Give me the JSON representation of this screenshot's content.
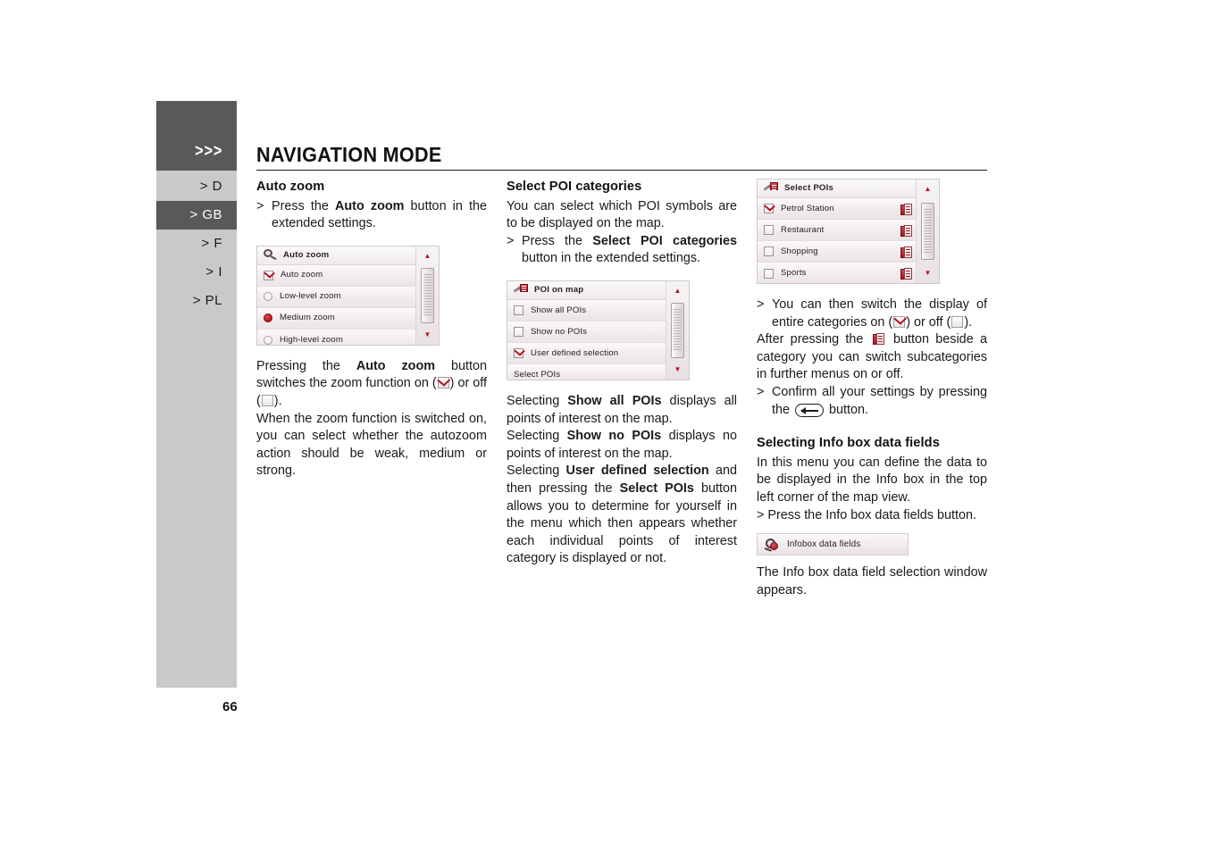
{
  "sidebar": {
    "chevrons": ">>>",
    "languages": [
      {
        "label": "> D",
        "active": false
      },
      {
        "label": "> GB",
        "active": true
      },
      {
        "label": "> F",
        "active": false
      },
      {
        "label": "> I",
        "active": false
      },
      {
        "label": "> PL",
        "active": false
      }
    ]
  },
  "header": {
    "title": "NAVIGATION MODE"
  },
  "page_number": "66",
  "col1": {
    "heading": "Auto zoom",
    "bullet1_pre": "Press the ",
    "bullet1_bold": "Auto zoom",
    "bullet1_post": " button in the extended settings.",
    "menu": {
      "title": "Auto zoom",
      "title_icon": "magnifier-icon",
      "rows": [
        {
          "label": "Auto zoom",
          "control": "checkbox",
          "state": "checked"
        },
        {
          "label": "Low-level zoom",
          "control": "radio",
          "state": "off"
        },
        {
          "label": "Medium zoom",
          "control": "radio",
          "state": "on"
        },
        {
          "label": "High-level zoom",
          "control": "radio",
          "state": "off"
        }
      ]
    },
    "para1_a": "Pressing the ",
    "para1_b": "Auto zoom",
    "para1_c": " button switches the zoom function on (",
    "para1_d": ") or off (",
    "para1_e": ").",
    "para2": "When the zoom function is switched on, you can select whether the autozoom action should be weak, medium or strong."
  },
  "col2": {
    "heading": "Select POI categories",
    "intro": "You can select which POI symbols are to be displayed on the map.",
    "bullet1_pre": "Press the ",
    "bullet1_bold": "Select POI categories",
    "bullet1_post": " button in the extended settings.",
    "menu": {
      "title": "POI on map",
      "title_icon": "poi-pen-icon",
      "rows": [
        {
          "label": "Show all POIs",
          "control": "checkbox",
          "state": "unchecked"
        },
        {
          "label": "Show no POIs",
          "control": "checkbox",
          "state": "unchecked"
        },
        {
          "label": "User defined selection",
          "control": "checkbox",
          "state": "checked"
        },
        {
          "label": "Select POIs",
          "control": "none",
          "state": ""
        }
      ]
    },
    "para1_a": "Selecting ",
    "para1_b": "Show all POIs",
    "para1_c": " displays all points of interest on the map.",
    "para2_a": "Selecting ",
    "para2_b": "Show no POIs",
    "para2_c": " displays no points of interest on the map.",
    "para3_a": "Selecting ",
    "para3_b": "User defined selection",
    "para3_c": " and then pressing the ",
    "para3_d": "Select POIs",
    "para3_e": " button allows you to determine for yourself in the menu which then appears whether each individual points of interest category is displayed or not."
  },
  "col3": {
    "menu": {
      "title": "Select POIs",
      "title_icon": "poi-pen-icon",
      "rows": [
        {
          "label": "Petrol Station",
          "control": "checkbox",
          "state": "checked",
          "has_doc_button": true
        },
        {
          "label": "Restaurant",
          "control": "checkbox",
          "state": "unchecked",
          "has_doc_button": true
        },
        {
          "label": "Shopping",
          "control": "checkbox",
          "state": "unchecked",
          "has_doc_button": true
        },
        {
          "label": "Sports",
          "control": "checkbox",
          "state": "unchecked",
          "has_doc_button": true
        }
      ]
    },
    "bullet1_a": "You can then switch the display of entire categories on (",
    "bullet1_b": ") or off (",
    "bullet1_c": ").",
    "para1_a": "After pressing the ",
    "para1_b": " button beside a category you can switch subcategories in further menus on or off.",
    "bullet2_a": "Confirm all your settings by pressing the ",
    "bullet2_b": " button.",
    "heading2": "Selecting Info box data fields",
    "para2": "In this menu you can define the data to be displayed in the Info box in the top left corner of the map view.",
    "bullet3": "Press the Info box data fields button.",
    "button": {
      "label": "Infobox data fields",
      "icon": "infobox-icon"
    },
    "para3": "The Info box data field selection window appears."
  },
  "colors": {
    "sidebar_light": "#c9c9c9",
    "sidebar_dark": "#595959",
    "accent_red": "#b5121b",
    "text": "#1a1a1a",
    "page_bg": "#ffffff"
  }
}
